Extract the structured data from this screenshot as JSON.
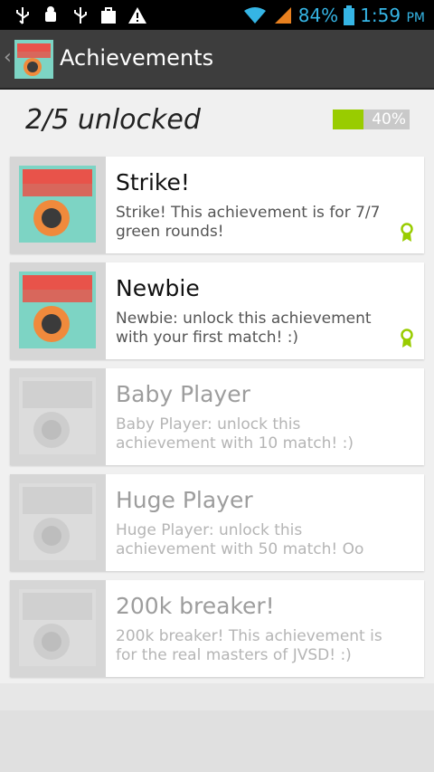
{
  "status_bar": {
    "battery_percent": "84%",
    "time": "1:59",
    "time_suffix": "PM",
    "icons": [
      "usb-icon",
      "android-debug-icon",
      "usb-icon",
      "bag-icon",
      "warning-icon",
      "wifi-icon",
      "signal-icon",
      "battery-icon"
    ]
  },
  "action_bar": {
    "title": "Achievements",
    "app_icon": "justin-vs-direction-logo"
  },
  "summary": {
    "unlocked_text": "2/5 unlocked",
    "progress_label": "40%",
    "progress_fraction": 0.4,
    "progress_color": "#99cc00"
  },
  "achievements": [
    {
      "name": "Strike!",
      "description": "Strike! This achievement is for 7/7 green rounds!",
      "unlocked": true,
      "icon": "award-ribbon-icon"
    },
    {
      "name": "Newbie",
      "description": "Newbie: unlock this achievement with your first match! :)",
      "unlocked": true,
      "icon": "award-ribbon-icon"
    },
    {
      "name": "Baby Player",
      "description": "Baby Player: unlock this achievement with 10 match! :)",
      "unlocked": false
    },
    {
      "name": "Huge Player",
      "description": "Huge Player: unlock this achievement with 50 match! Oo",
      "unlocked": false
    },
    {
      "name": "200k breaker!",
      "description": "200k breaker! This achievement is for the real masters of JVSD! :)",
      "unlocked": false
    }
  ],
  "colors": {
    "accent": "#35b5e5",
    "action_bar": "#3d3d3d",
    "award": "#99cc00"
  }
}
